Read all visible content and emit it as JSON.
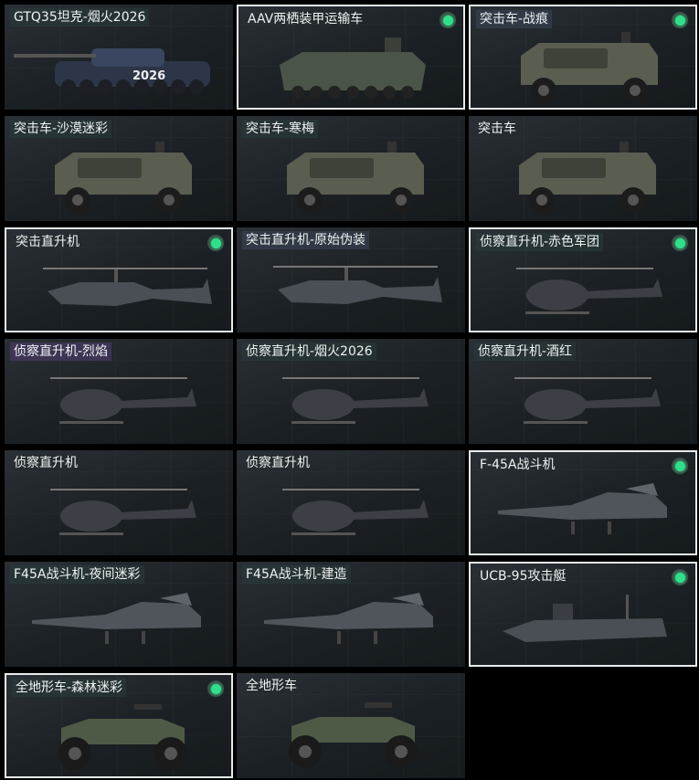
{
  "cards": [
    {
      "label": "GTQ35坦克-烟火2026",
      "selected": false,
      "equipped": false,
      "vehicle": "tank-icon",
      "tag": "teal"
    },
    {
      "label": "AAV两栖装甲运输车",
      "selected": true,
      "equipped": true,
      "vehicle": "amphibious-vehicle-icon",
      "tag": "none"
    },
    {
      "label": "突击车-战痕",
      "selected": true,
      "equipped": true,
      "vehicle": "assault-vehicle-icon",
      "tag": "slate"
    },
    {
      "label": "突击车-沙漠迷彩",
      "selected": false,
      "equipped": false,
      "vehicle": "assault-vehicle-icon",
      "tag": "teal"
    },
    {
      "label": "突击车-寒梅",
      "selected": false,
      "equipped": false,
      "vehicle": "assault-vehicle-icon",
      "tag": "teal"
    },
    {
      "label": "突击车",
      "selected": false,
      "equipped": false,
      "vehicle": "assault-vehicle-icon",
      "tag": "none"
    },
    {
      "label": "突击直升机",
      "selected": true,
      "equipped": true,
      "vehicle": "attack-helicopter-icon",
      "tag": "none"
    },
    {
      "label": "突击直升机-原始伪装",
      "selected": false,
      "equipped": false,
      "vehicle": "attack-helicopter-icon",
      "tag": "slate"
    },
    {
      "label": "侦察直升机-赤色军团",
      "selected": true,
      "equipped": true,
      "vehicle": "scout-helicopter-icon",
      "tag": "teal"
    },
    {
      "label": "侦察直升机-烈焰",
      "selected": false,
      "equipped": false,
      "vehicle": "scout-helicopter-icon",
      "tag": "purple"
    },
    {
      "label": "侦察直升机-烟火2026",
      "selected": false,
      "equipped": false,
      "vehicle": "scout-helicopter-icon",
      "tag": "teal"
    },
    {
      "label": "侦察直升机-酒红",
      "selected": false,
      "equipped": false,
      "vehicle": "scout-helicopter-icon",
      "tag": "teal"
    },
    {
      "label": "侦察直升机",
      "selected": false,
      "equipped": false,
      "vehicle": "scout-helicopter-icon",
      "tag": "none"
    },
    {
      "label": "侦察直升机",
      "selected": false,
      "equipped": false,
      "vehicle": "scout-helicopter-icon",
      "tag": "none"
    },
    {
      "label": "F-45A战斗机",
      "selected": true,
      "equipped": true,
      "vehicle": "fighter-jet-icon",
      "tag": "none"
    },
    {
      "label": "F45A战斗机-夜间迷彩",
      "selected": false,
      "equipped": false,
      "vehicle": "fighter-jet-icon",
      "tag": "teal"
    },
    {
      "label": "F45A战斗机-建造",
      "selected": false,
      "equipped": false,
      "vehicle": "fighter-jet-icon",
      "tag": "teal"
    },
    {
      "label": "UCB-95攻击艇",
      "selected": true,
      "equipped": true,
      "vehicle": "attack-boat-icon",
      "tag": "none"
    },
    {
      "label": "全地形车-森林迷彩",
      "selected": true,
      "equipped": true,
      "vehicle": "atv-icon",
      "tag": "teal"
    },
    {
      "label": "全地形车",
      "selected": false,
      "equipped": false,
      "vehicle": "atv-icon",
      "tag": "none"
    }
  ],
  "colors": {
    "selected_border": "#e8ecec",
    "equipped_dot": "#2fe08a",
    "background": "#000000"
  }
}
